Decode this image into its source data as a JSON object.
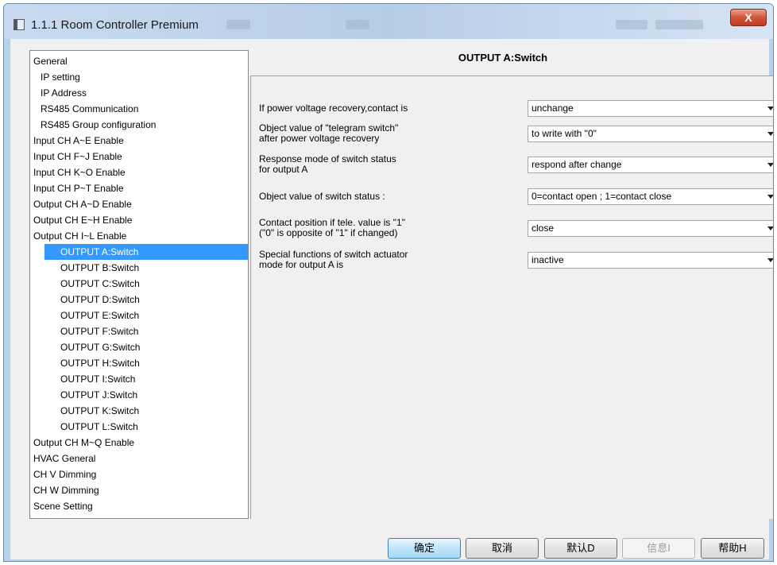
{
  "window": {
    "title": "1.1.1 Room Controller Premium",
    "close_label": "X"
  },
  "tree": {
    "items": [
      {
        "label": "General",
        "indent": 0
      },
      {
        "label": "IP setting",
        "indent": 1
      },
      {
        "label": "IP Address",
        "indent": 1
      },
      {
        "label": "RS485 Communication",
        "indent": 1
      },
      {
        "label": "RS485 Group configuration",
        "indent": 1
      },
      {
        "label": "Input CH A~E Enable",
        "indent": 0
      },
      {
        "label": "Input CH F~J Enable",
        "indent": 0
      },
      {
        "label": "Input CH K~O Enable",
        "indent": 0
      },
      {
        "label": "Input CH P~T Enable",
        "indent": 0
      },
      {
        "label": "Output CH A~D Enable",
        "indent": 0
      },
      {
        "label": "Output CH E~H Enable",
        "indent": 0
      },
      {
        "label": "Output CH I~L Enable",
        "indent": 0
      },
      {
        "label": "OUTPUT A:Switch",
        "indent": 2,
        "selected": true
      },
      {
        "label": "OUTPUT B:Switch",
        "indent": 2
      },
      {
        "label": "OUTPUT C:Switch",
        "indent": 2
      },
      {
        "label": "OUTPUT D:Switch",
        "indent": 2
      },
      {
        "label": "OUTPUT E:Switch",
        "indent": 2
      },
      {
        "label": "OUTPUT F:Switch",
        "indent": 2
      },
      {
        "label": "OUTPUT G:Switch",
        "indent": 2
      },
      {
        "label": "OUTPUT H:Switch",
        "indent": 2
      },
      {
        "label": "OUTPUT I:Switch",
        "indent": 2
      },
      {
        "label": "OUTPUT J:Switch",
        "indent": 2
      },
      {
        "label": "OUTPUT K:Switch",
        "indent": 2
      },
      {
        "label": "OUTPUT L:Switch",
        "indent": 2
      },
      {
        "label": "Output CH M~Q Enable",
        "indent": 0
      },
      {
        "label": "HVAC General",
        "indent": 0
      },
      {
        "label": "CH V Dimming",
        "indent": 0
      },
      {
        "label": "CH W Dimming",
        "indent": 0
      },
      {
        "label": "Scene Setting",
        "indent": 0
      }
    ]
  },
  "panel": {
    "title": "OUTPUT A:Switch",
    "params": [
      {
        "label_lines": [
          "If power voltage recovery,contact is"
        ],
        "value": "unchange"
      },
      {
        "label_lines": [
          "Object value of \"telegram switch\"",
          "after power voltage recovery"
        ],
        "value": "to write with \"0\""
      },
      {
        "label_lines": [
          "Response mode of switch status",
          "for output A"
        ],
        "value": "respond after change"
      },
      {
        "label_lines": [
          "Object value of switch status :"
        ],
        "value": "0=contact open ; 1=contact close"
      },
      {
        "label_lines": [
          "Contact position if tele. value is \"1\"",
          " (\"0\" is opposite of \"1\" if changed)"
        ],
        "value": "close"
      },
      {
        "label_lines": [
          "Special functions of switch actuator",
          " mode for output A is"
        ],
        "value": "inactive"
      }
    ]
  },
  "buttons": {
    "ok": "确定",
    "cancel": "取消",
    "default": "默认D",
    "info": "信息I",
    "help": "帮助H"
  },
  "icons": {
    "app": "window-app-icon",
    "dropdown": "chevron-down-icon"
  }
}
